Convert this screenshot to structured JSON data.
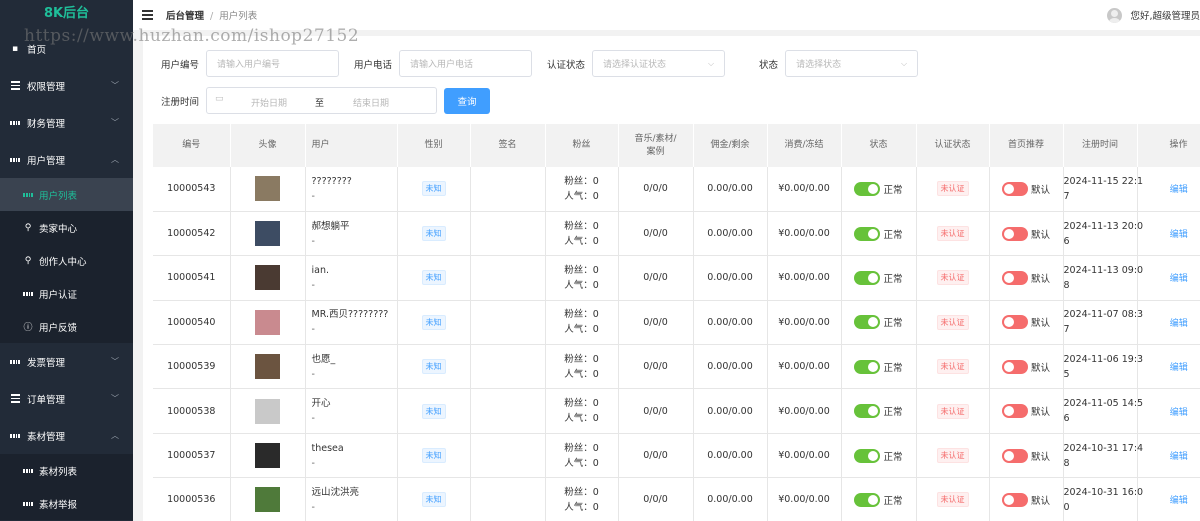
{
  "sidebar": {
    "logo": "8K后台",
    "items": [
      {
        "label": "首页",
        "icon": "dashboard-icon",
        "type": "menu"
      },
      {
        "label": "权限管理",
        "icon": "list-icon",
        "type": "menu",
        "chevron": "down"
      },
      {
        "label": "财务管理",
        "icon": "grid-icon",
        "type": "menu",
        "chevron": "down"
      },
      {
        "label": "用户管理",
        "icon": "grid-icon",
        "type": "menu",
        "chevron": "up"
      },
      {
        "label": "用户列表",
        "icon": "grid-icon",
        "type": "sub",
        "active": true
      },
      {
        "label": "卖家中心",
        "icon": "user-icon",
        "type": "sub"
      },
      {
        "label": "创作人中心",
        "icon": "user-icon",
        "type": "sub"
      },
      {
        "label": "用户认证",
        "icon": "grid-icon",
        "type": "sub"
      },
      {
        "label": "用户反馈",
        "icon": "info-icon",
        "type": "sub"
      },
      {
        "label": "发票管理",
        "icon": "grid-icon",
        "type": "menu",
        "chevron": "down"
      },
      {
        "label": "订单管理",
        "icon": "list-icon",
        "type": "menu",
        "chevron": "down"
      },
      {
        "label": "素材管理",
        "icon": "grid-icon",
        "type": "menu",
        "chevron": "up"
      },
      {
        "label": "素材列表",
        "icon": "grid-icon",
        "type": "sub"
      },
      {
        "label": "素材举报",
        "icon": "grid-icon",
        "type": "sub"
      }
    ]
  },
  "header": {
    "breadcrumb_root": "后台管理",
    "breadcrumb_sep": "/",
    "breadcrumb_current": "用户列表",
    "user_greeting": "您好,超级管理员"
  },
  "watermark": "https://www.huzhan.com/ishop27152",
  "filters": {
    "user_id_label": "用户编号",
    "user_id_placeholder": "请输入用户编号",
    "phone_label": "用户电话",
    "phone_placeholder": "请输入用户电话",
    "cert_label": "认证状态",
    "cert_placeholder": "请选择认证状态",
    "status_label": "状态",
    "status_placeholder": "请选择状态",
    "date_label": "注册时间",
    "date_start": "开始日期",
    "date_to": "至",
    "date_end": "结束日期",
    "query_button": "查询"
  },
  "table": {
    "columns": [
      "编号",
      "头像",
      "用户",
      "性别",
      "签名",
      "粉丝",
      "音乐/素材/案例",
      "佣金/剩余",
      "消费/冻结",
      "状态",
      "认证状态",
      "首页推荐",
      "注册时间",
      "操作"
    ],
    "rows": [
      {
        "id": "10000543",
        "avatar_color": "#8a7a62",
        "name": "????????",
        "sub": "-",
        "gender": "未知",
        "fans": "粉丝：0",
        "popularity": "人气：0",
        "works": "0/0/0",
        "commission": "0.00/0.00",
        "spend": "¥0.00/0.00",
        "status": "正常",
        "cert": "未认证",
        "recommend": "默认",
        "time": "2024-11-15 22:17",
        "action": "编辑"
      },
      {
        "id": "10000542",
        "avatar_color": "#3d4c63",
        "name": "郝想躺平",
        "sub": "-",
        "gender": "未知",
        "fans": "粉丝：0",
        "popularity": "人气：0",
        "works": "0/0/0",
        "commission": "0.00/0.00",
        "spend": "¥0.00/0.00",
        "status": "正常",
        "cert": "未认证",
        "recommend": "默认",
        "time": "2024-11-13 20:06",
        "action": "编辑"
      },
      {
        "id": "10000541",
        "avatar_color": "#4a3a32",
        "name": "ian.",
        "sub": "-",
        "gender": "未知",
        "fans": "粉丝：0",
        "popularity": "人气：0",
        "works": "0/0/0",
        "commission": "0.00/0.00",
        "spend": "¥0.00/0.00",
        "status": "正常",
        "cert": "未认证",
        "recommend": "默认",
        "time": "2024-11-13 09:08",
        "action": "编辑"
      },
      {
        "id": "10000540",
        "avatar_color": "#c98a8f",
        "name": "MR.西贝????????",
        "sub": "-",
        "gender": "未知",
        "fans": "粉丝：0",
        "popularity": "人气：0",
        "works": "0/0/0",
        "commission": "0.00/0.00",
        "spend": "¥0.00/0.00",
        "status": "正常",
        "cert": "未认证",
        "recommend": "默认",
        "time": "2024-11-07 08:37",
        "action": "编辑"
      },
      {
        "id": "10000539",
        "avatar_color": "#6b5440",
        "name": "也愿_",
        "sub": "-",
        "gender": "未知",
        "fans": "粉丝：0",
        "popularity": "人气：0",
        "works": "0/0/0",
        "commission": "0.00/0.00",
        "spend": "¥0.00/0.00",
        "status": "正常",
        "cert": "未认证",
        "recommend": "默认",
        "time": "2024-11-06 19:35",
        "action": "编辑"
      },
      {
        "id": "10000538",
        "avatar_color": "#c9c9c9",
        "name": "开心",
        "sub": "-",
        "gender": "未知",
        "fans": "粉丝：0",
        "popularity": "人气：0",
        "works": "0/0/0",
        "commission": "0.00/0.00",
        "spend": "¥0.00/0.00",
        "status": "正常",
        "cert": "未认证",
        "recommend": "默认",
        "time": "2024-11-05 14:56",
        "action": "编辑"
      },
      {
        "id": "10000537",
        "avatar_color": "#2a2a2a",
        "name": "thesea",
        "sub": "-",
        "gender": "未知",
        "fans": "粉丝：0",
        "popularity": "人气：0",
        "works": "0/0/0",
        "commission": "0.00/0.00",
        "spend": "¥0.00/0.00",
        "status": "正常",
        "cert": "未认证",
        "recommend": "默认",
        "time": "2024-10-31 17:48",
        "action": "编辑"
      },
      {
        "id": "10000536",
        "avatar_color": "#4f7a3a",
        "name": "远山沈洪亮",
        "sub": "-",
        "gender": "未知",
        "fans": "粉丝：0",
        "popularity": "人气：0",
        "works": "0/0/0",
        "commission": "0.00/0.00",
        "spend": "¥0.00/0.00",
        "status": "正常",
        "cert": "未认证",
        "recommend": "默认",
        "time": "2024-10-31 16:00",
        "action": "编辑"
      }
    ]
  }
}
